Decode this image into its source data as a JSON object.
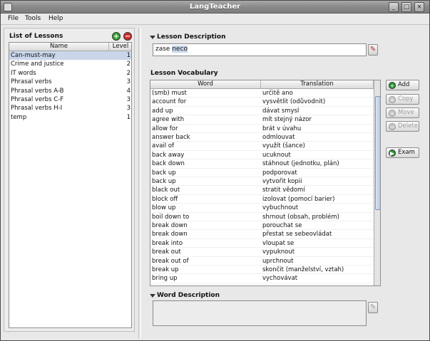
{
  "window": {
    "title": "LangTeacher",
    "controls": [
      "_",
      "□",
      "×"
    ]
  },
  "menu": [
    "File",
    "Tools",
    "Help"
  ],
  "lessons": {
    "title": "List of Lessons",
    "columns": [
      "Name",
      "Level"
    ],
    "rows": [
      {
        "name": "Can-must-may",
        "level": "1",
        "selected": true
      },
      {
        "name": "Crime and justice",
        "level": "2"
      },
      {
        "name": "IT words",
        "level": "2"
      },
      {
        "name": "Phrasal verbs",
        "level": "3"
      },
      {
        "name": "Phrasal verbs A-B",
        "level": "4"
      },
      {
        "name": "Phrasal verbs C-F",
        "level": "3"
      },
      {
        "name": "Phrasal verbs H-I",
        "level": "3"
      },
      {
        "name": "temp",
        "level": "1"
      }
    ]
  },
  "lesson_description": {
    "title": "Lesson Description",
    "value_prefix": "zase ",
    "value_highlighted": "neco"
  },
  "vocabulary": {
    "title": "Lesson Vocabulary",
    "columns": [
      "Word",
      "Translation"
    ],
    "rows": [
      [
        "(smb) must",
        "určitě ano"
      ],
      [
        "account for",
        "vysvětlit (odůvodnit)"
      ],
      [
        "add up",
        "dávat smysl"
      ],
      [
        "agree with",
        "mít stejný názor"
      ],
      [
        "allow for",
        "brát v úvahu"
      ],
      [
        "answer back",
        "odmlouvat"
      ],
      [
        "avail of",
        "využít (šance)"
      ],
      [
        "back away",
        "ucuknout"
      ],
      [
        "back down",
        "stáhnout (jednotku, plán)"
      ],
      [
        "back up",
        "podporovat"
      ],
      [
        "back up",
        "vytvořit kopii"
      ],
      [
        "black out",
        "stratit vědomí"
      ],
      [
        "block off",
        "izolovat (pomocí barier)"
      ],
      [
        "blow up",
        "vybuchnout"
      ],
      [
        "boil down to",
        "shrnout (obsah, problém)"
      ],
      [
        "break down",
        "porouchat se"
      ],
      [
        "break down",
        "přestat se sebeovládat"
      ],
      [
        "break into",
        "vloupat se"
      ],
      [
        "break out",
        "vypuknout"
      ],
      [
        "break out of",
        "uprchnout"
      ],
      [
        "break up",
        "skončit (manželství, vztah)"
      ],
      [
        "bring up",
        "vychovávat"
      ]
    ]
  },
  "buttons": {
    "add": "Add",
    "copy": "Copy",
    "move": "Move",
    "delete": "Delete",
    "exam": "Exam"
  },
  "word_description": {
    "title": "Word Description",
    "value": ""
  },
  "colors": {
    "selection": "#c9d6ea",
    "add_green": "#2aa62a",
    "remove_red": "#d22b2b"
  }
}
